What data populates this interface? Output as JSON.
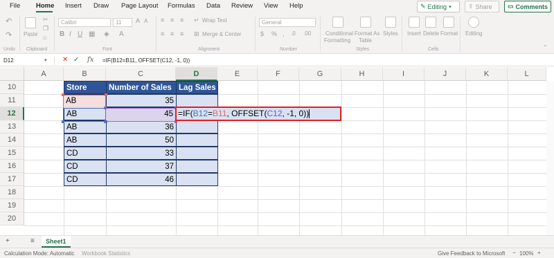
{
  "menu": {
    "items": [
      "File",
      "Home",
      "Insert",
      "Draw",
      "Page Layout",
      "Formulas",
      "Data",
      "Review",
      "View",
      "Help"
    ],
    "editing_label": "Editing",
    "share_label": "Share",
    "comments_label": "Comments"
  },
  "ribbon": {
    "undo_label": "Undo",
    "paste_label": "Paste",
    "clipboard_label": "Clipboard",
    "font_name": "Calibri",
    "font_size": "11",
    "font_label": "Font",
    "wrap_text_label": "Wrap Text",
    "merge_center_label": "Merge & Center",
    "alignment_label": "Alignment",
    "number_format": "General",
    "number_label": "Number",
    "conditional_formatting_label_1": "Conditional",
    "conditional_formatting_label_2": "Formatting",
    "format_as_table_label_1": "Format As",
    "format_as_table_label_2": "Table",
    "styles_button_label": "Styles",
    "styles_label": "Styles",
    "insert_label": "Insert",
    "delete_label": "Delete",
    "format_label": "Format",
    "cells_label": "Cells",
    "editing_group_label": "Editing"
  },
  "formula_bar": {
    "name_box": "D12",
    "formula": "=IF(B12=B11, OFFSET(C12, -1, 0))"
  },
  "grid": {
    "columns": [
      "A",
      "B",
      "C",
      "D",
      "E",
      "F",
      "G",
      "H",
      "I",
      "J",
      "K",
      "L"
    ],
    "rows": [
      "10",
      "11",
      "12",
      "13",
      "14",
      "15",
      "16",
      "17",
      "18",
      "19",
      "20"
    ],
    "selected_column": "D",
    "selected_row": "12"
  },
  "table": {
    "headers": [
      "Store",
      "Number of Sales",
      "Lag Sales"
    ],
    "stores": [
      "AB",
      "AB",
      "AB",
      "AB",
      "CD",
      "CD",
      "CD"
    ],
    "sales": [
      "35",
      "45",
      "36",
      "50",
      "33",
      "37",
      "46"
    ]
  },
  "editing_formula": {
    "p1": "=IF(",
    "p2": "B12",
    "p3": "=",
    "p4": "B11",
    "p5": ", OFFSET(",
    "p6": "C12",
    "p7": ", -1, 0))"
  },
  "sheet_tab": "Sheet1",
  "status": {
    "calc_mode": "Calculation Mode: Automatic",
    "workbook_stats": "Workbook Statistics",
    "feedback": "Give Feedback to Microsoft",
    "zoom": "100%"
  }
}
